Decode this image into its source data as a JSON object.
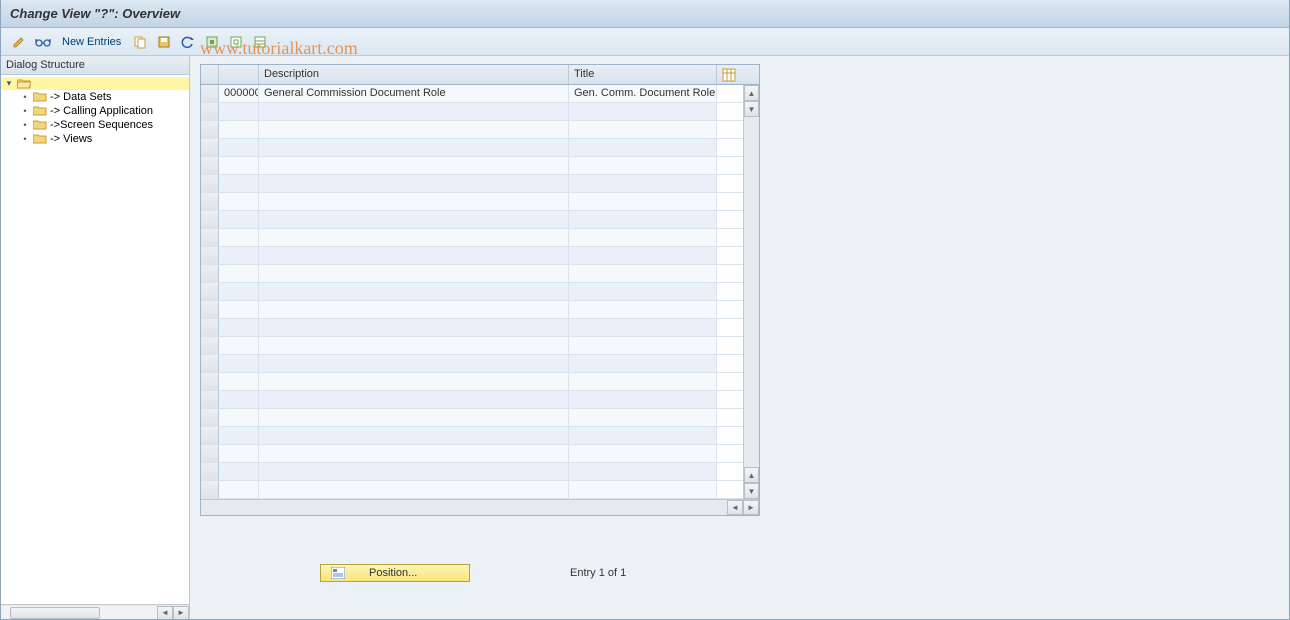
{
  "title": "Change View \"?\": Overview",
  "toolbar": {
    "new_entries": "New Entries"
  },
  "watermark": "www.tutorialkart.com",
  "dialog": {
    "header": "Dialog Structure",
    "items": [
      {
        "label": "-> Data Sets"
      },
      {
        "label": "-> Calling Application"
      },
      {
        "label": "->Screen Sequences"
      },
      {
        "label": "-> Views"
      }
    ]
  },
  "table": {
    "columns": {
      "description": "Description",
      "title": "Title"
    },
    "rows": [
      {
        "id": "000000",
        "description": "General Commission Document Role",
        "title": "Gen. Comm. Document Role"
      }
    ]
  },
  "footer": {
    "position": "Position...",
    "entry": "Entry 1 of 1"
  }
}
